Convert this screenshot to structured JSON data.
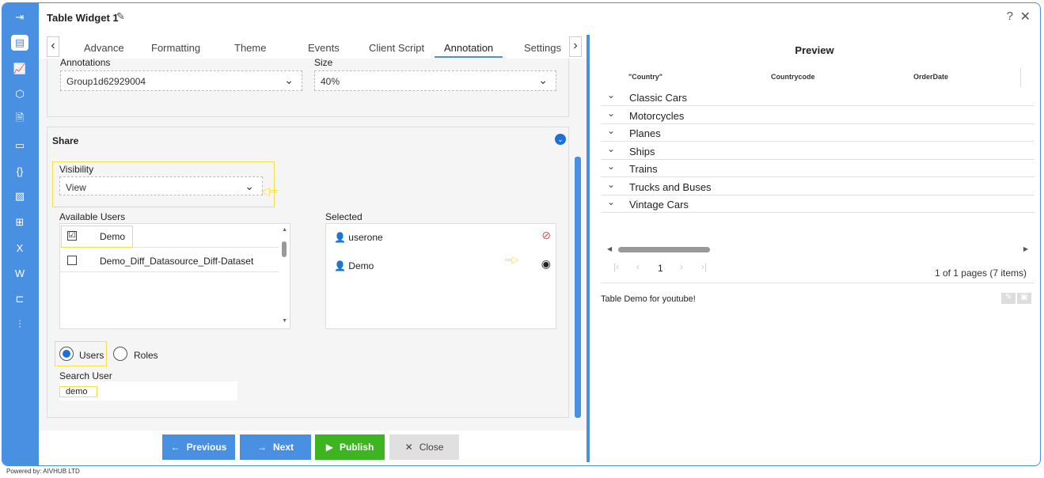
{
  "window": {
    "title": "Table Widget 1"
  },
  "tabs": [
    {
      "label": "Advance"
    },
    {
      "label": "Formatting"
    },
    {
      "label": "Theme"
    },
    {
      "label": "Events"
    },
    {
      "label": "Client Script"
    },
    {
      "label": "Annotation"
    },
    {
      "label": "Settings"
    }
  ],
  "annotations": {
    "label": "Annotations",
    "value": "Group1d62929004",
    "size_label": "Size",
    "size_value": "40%"
  },
  "share": {
    "title": "Share",
    "visibility_label": "Visibility",
    "visibility_value": "View",
    "available_label": "Available Users",
    "selected_label": "Selected",
    "available_users": [
      {
        "name": "Demo",
        "checked": "☑"
      },
      {
        "name": "Demo_Diff_Datasource_Diff-Dataset",
        "checked": ""
      }
    ],
    "selected_users": [
      {
        "name": "userone"
      },
      {
        "name": "Demo"
      }
    ],
    "radio_users": "Users",
    "radio_roles": "Roles",
    "search_label": "Search User",
    "search_value": "demo"
  },
  "buttons": {
    "previous": "Previous",
    "next": "Next",
    "publish": "Publish",
    "close": "Close"
  },
  "preview": {
    "title": "Preview",
    "columns": [
      "\"Country\"",
      "Countrycode",
      "OrderDate"
    ],
    "groups": [
      "Classic Cars",
      "Motorcycles",
      "Planes",
      "Ships",
      "Trains",
      "Trucks and Buses",
      "Vintage Cars"
    ],
    "page": "1",
    "page_info": "1 of 1 pages (7 items)",
    "note": "Table Demo for youtube!"
  },
  "footer": {
    "powered": "Powered by: AIVHUB LTD"
  },
  "colors": {
    "accent": "#4a90e2",
    "publish": "#3cb521",
    "highlight": "#f2e24a"
  }
}
